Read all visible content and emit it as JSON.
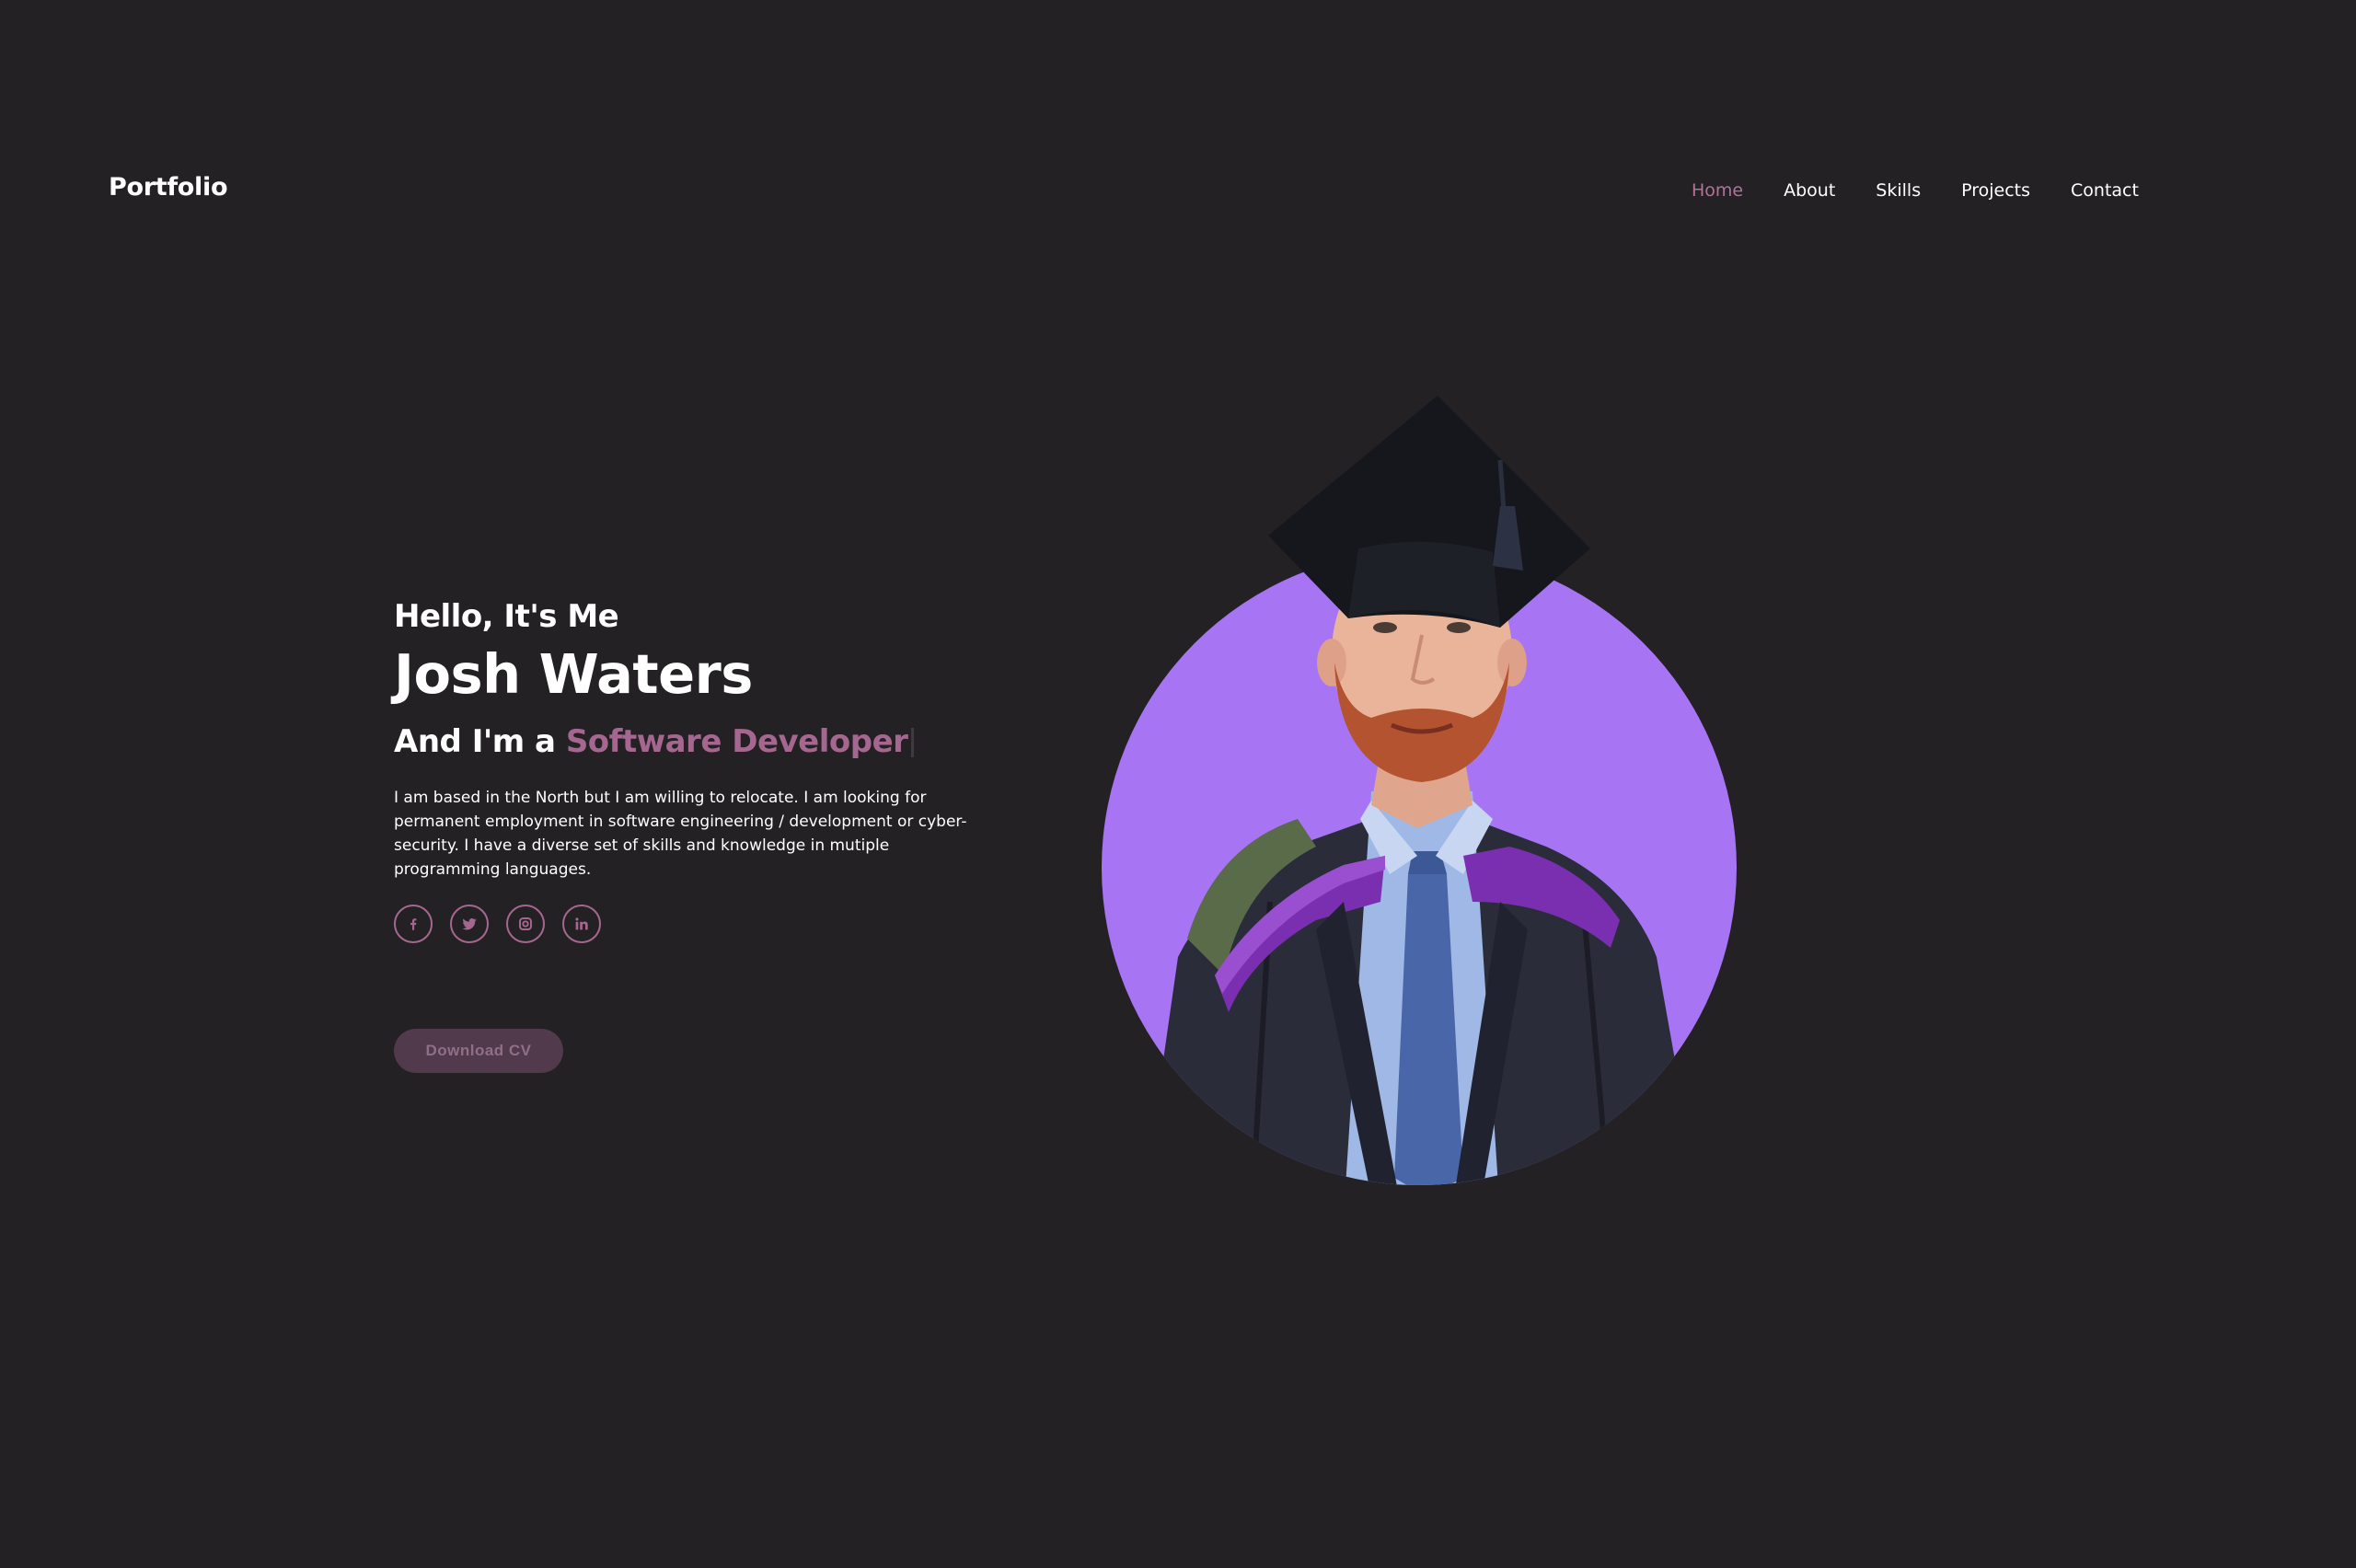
{
  "header": {
    "logo": "Portfolio",
    "nav": [
      {
        "label": "Home",
        "active": true
      },
      {
        "label": "About",
        "active": false
      },
      {
        "label": "Skills",
        "active": false
      },
      {
        "label": "Projects",
        "active": false
      },
      {
        "label": "Contact",
        "active": false
      }
    ]
  },
  "hero": {
    "greeting": "Hello, It's Me",
    "name": "Josh Waters",
    "role_prefix": "And I'm a",
    "role_typed": "Software Developer",
    "description": "I am based in the North but I am willing to relocate. I am looking for permanent employment in software engineering / development or cyber-security. I have a diverse set of skills and knowledge in mutiple programming languages.",
    "socials": [
      {
        "icon": "facebook-icon"
      },
      {
        "icon": "twitter-icon"
      },
      {
        "icon": "instagram-icon"
      },
      {
        "icon": "linkedin-icon"
      }
    ],
    "cv_button": "Download CV"
  },
  "colors": {
    "background": "#232124",
    "accent": "#a5678f",
    "circle": "#a775f4"
  }
}
